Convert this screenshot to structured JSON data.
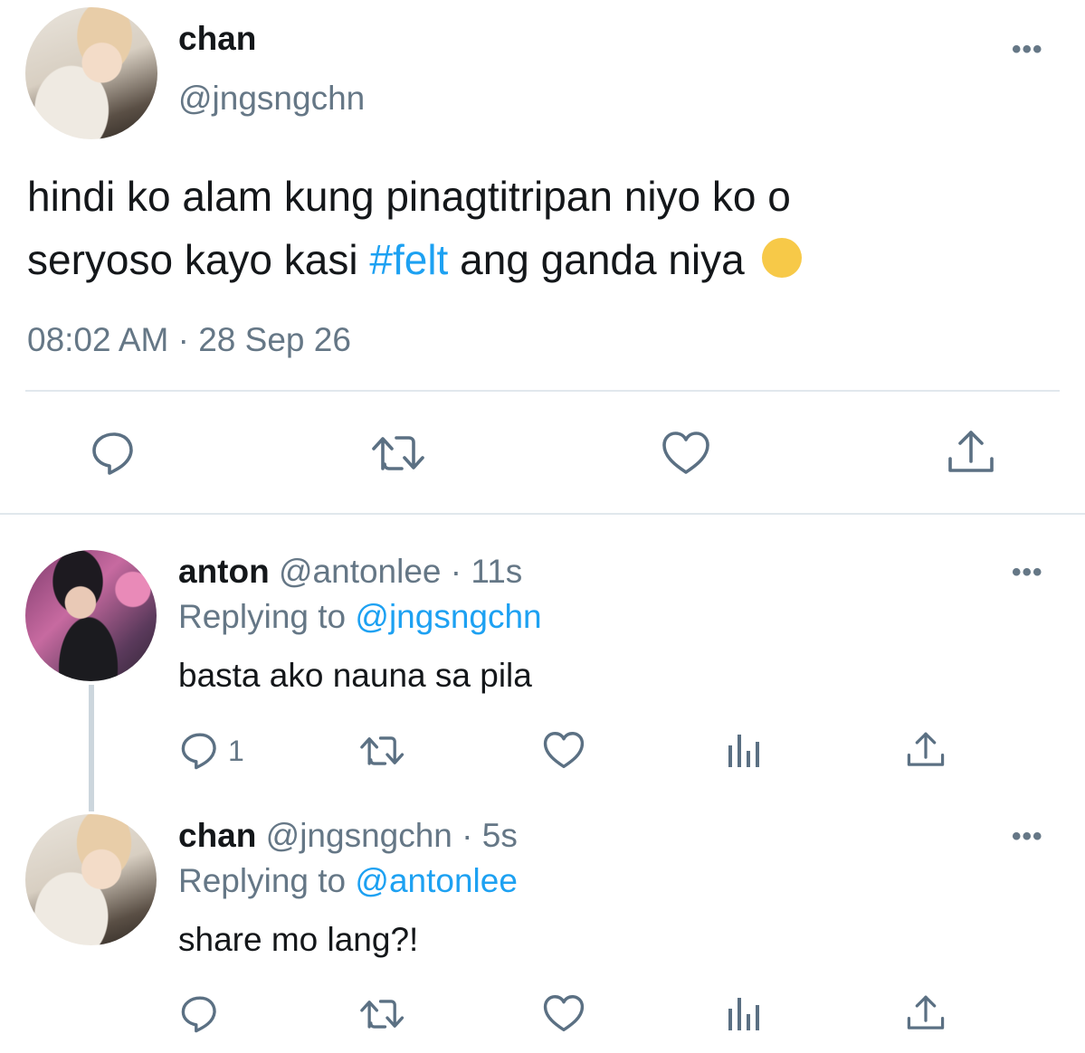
{
  "main_tweet": {
    "display_name": "chan",
    "handle": "@jngsngchn",
    "text_line1": "hindi ko alam kung pinagtitripan niyo ko o",
    "text_line2_before": "seryoso kayo kasi ",
    "hashtag": "#felt",
    "text_line2_after": " ang ganda niya",
    "emoji": "😔",
    "timestamp": "08:02 AM · 28 Sep 26",
    "actions": [
      "reply-icon",
      "retweet-icon",
      "like-icon",
      "share-icon"
    ]
  },
  "replies": [
    {
      "display_name": "anton",
      "handle": "@antonlee",
      "time": "· 11s",
      "replying_label": "Replying to ",
      "replying_to": "@jngsngchn",
      "text": "basta ako nauna sa pila",
      "reply_count": "1"
    },
    {
      "display_name": "chan",
      "handle": "@jngsngchn",
      "time": "· 5s",
      "replying_label": "Replying to ",
      "replying_to": "@antonlee",
      "text": "share mo lang?!",
      "reply_count": ""
    }
  ],
  "colors": {
    "link": "#1da1f2",
    "muted": "#657786",
    "icon": "#5b7083",
    "thread_line": "#ccd6dd"
  }
}
